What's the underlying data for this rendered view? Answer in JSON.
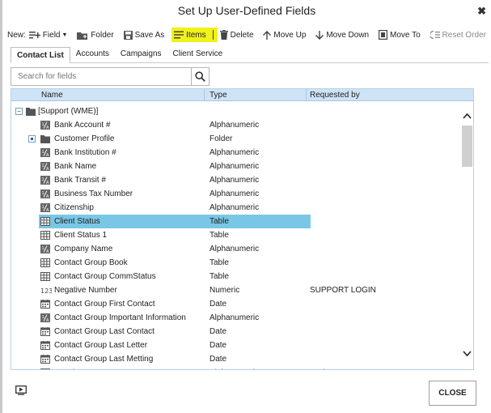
{
  "window": {
    "title": "Set Up User-Defined Fields",
    "close_glyph": "✖"
  },
  "toolbar": {
    "new_label": "New:",
    "field_label": "Field",
    "folder_label": "Folder",
    "save_as_label": "Save As",
    "items_label": "Items",
    "delete_label": "Delete",
    "move_up_label": "Move Up",
    "move_down_label": "Move Down",
    "move_to_label": "Move To",
    "reset_order_label": "Reset Order",
    "highlight_color": "#f0f21a"
  },
  "tabs": [
    {
      "label": "Contact List",
      "active": true
    },
    {
      "label": "Accounts",
      "active": false
    },
    {
      "label": "Campaigns",
      "active": false
    },
    {
      "label": "Client Service",
      "active": false
    }
  ],
  "search": {
    "placeholder": "Search for fields",
    "value": ""
  },
  "grid": {
    "columns": [
      "Name",
      "Type",
      "Requested by"
    ],
    "root_label": "[Support (WME)]",
    "selection_color": "#7ac7e5",
    "header_color": "#cfe3f6",
    "rows": [
      {
        "name": "Bank Account #",
        "type": "Alphanumeric",
        "requested_by": "",
        "icon": "alphanumeric-icon"
      },
      {
        "name": "Customer Profile",
        "type": "Folder",
        "requested_by": "",
        "icon": "folder-icon"
      },
      {
        "name": "Bank Institution #",
        "type": "Alphanumeric",
        "requested_by": "",
        "icon": "alphanumeric-icon"
      },
      {
        "name": "Bank Name",
        "type": "Alphanumeric",
        "requested_by": "",
        "icon": "alphanumeric-icon"
      },
      {
        "name": "Bank Transit #",
        "type": "Alphanumeric",
        "requested_by": "",
        "icon": "alphanumeric-icon"
      },
      {
        "name": "Business Tax Number",
        "type": "Alphanumeric",
        "requested_by": "",
        "icon": "alphanumeric-icon"
      },
      {
        "name": "Citizenship",
        "type": "Alphanumeric",
        "requested_by": "",
        "icon": "alphanumeric-icon"
      },
      {
        "name": "Client Status",
        "type": "Table",
        "requested_by": "",
        "icon": "table-icon",
        "selected": true
      },
      {
        "name": "Client Status 1",
        "type": "Table",
        "requested_by": "",
        "icon": "table-icon"
      },
      {
        "name": "Company Name",
        "type": "Alphanumeric",
        "requested_by": "",
        "icon": "alphanumeric-icon"
      },
      {
        "name": "Contact Group Book",
        "type": "Table",
        "requested_by": "",
        "icon": "table-icon"
      },
      {
        "name": "Contact Group CommStatus",
        "type": "Table",
        "requested_by": "",
        "icon": "table-icon"
      },
      {
        "name": "Negative Number",
        "type": "Numeric",
        "requested_by": "SUPPORT LOGIN",
        "icon": "numeric-icon"
      },
      {
        "name": "Contact Group First Contact",
        "type": "Date",
        "requested_by": "",
        "icon": "calendar-icon"
      },
      {
        "name": "Contact Group Important Information",
        "type": "Alphanumeric",
        "requested_by": "",
        "icon": "alphanumeric-icon"
      },
      {
        "name": "Contact Group Last Contact",
        "type": "Date",
        "requested_by": "",
        "icon": "calendar-icon"
      },
      {
        "name": "Contact Group Last Letter",
        "type": "Date",
        "requested_by": "",
        "icon": "calendar-icon"
      },
      {
        "name": "Contact Group Last Metting",
        "type": "Date",
        "requested_by": "",
        "icon": "calendar-icon"
      },
      {
        "name": "MandatoryText",
        "type": "Alphanumeric",
        "requested_by": "S Sheraz",
        "icon": "alphanumeric-icon"
      }
    ]
  },
  "footer": {
    "close_label": "CLOSE"
  }
}
